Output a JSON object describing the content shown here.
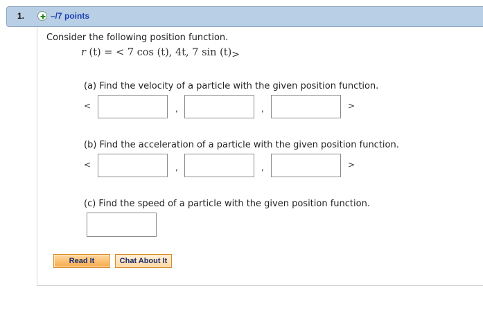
{
  "question": {
    "number": "1.",
    "points": "–/7 points",
    "prompt": "Consider the following position function.",
    "function": {
      "lhs": "r",
      "arg": "(t)",
      "eq_open": " = <",
      "coef1": "7",
      "func1": "cos",
      "arg1": "(t)",
      "comp2": "4t",
      "coef3": "7",
      "func3": "sin",
      "arg3": "(t)",
      "close": ">"
    },
    "parts": [
      {
        "label": "(a) Find the velocity of a particle with the given position function."
      },
      {
        "label": "(b) Find the acceleration of a particle with the given position function."
      },
      {
        "label": "(c) Find the speed of a particle with the given position function."
      }
    ],
    "vector_symbols": {
      "open": "<",
      "comma": ",",
      "close": ">"
    }
  },
  "buttons": {
    "read_it": "Read It",
    "chat_about_it": "Chat About It"
  },
  "colors": {
    "header_bg": "#b9cfe6",
    "points_text": "#1b3fb0",
    "button_orange": "#f7a94a"
  },
  "icons": {
    "add": "plus-circle-icon"
  }
}
